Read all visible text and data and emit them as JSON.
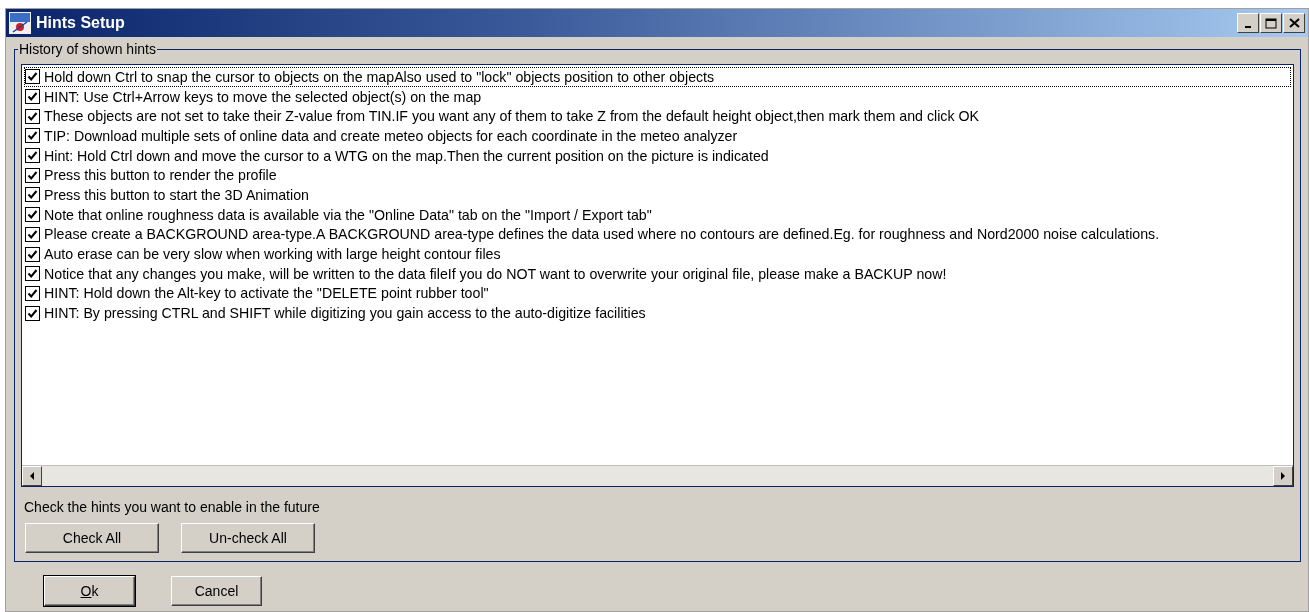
{
  "window": {
    "title": "Hints Setup"
  },
  "group": {
    "title": "History of shown hints"
  },
  "hints": [
    {
      "text": "Hold down Ctrl to snap the cursor to objects on the mapAlso used to \"lock\" objects position to other objects",
      "checked": true,
      "selected": true
    },
    {
      "text": "HINT: Use Ctrl+Arrow keys to move the selected object(s) on the map",
      "checked": true,
      "selected": false
    },
    {
      "text": "These objects are not set to take their Z-value from TIN.IF you want any of them to take Z from the default height object,then mark them and click OK",
      "checked": true,
      "selected": false
    },
    {
      "text": "TIP: Download multiple sets of online data and create meteo objects for each coordinate in the meteo analyzer",
      "checked": true,
      "selected": false
    },
    {
      "text": "Hint: Hold Ctrl down and move the cursor to a WTG on the map.Then the current position on the picture is indicated",
      "checked": true,
      "selected": false
    },
    {
      "text": "Press this button to render the profile",
      "checked": true,
      "selected": false
    },
    {
      "text": "Press this button to start the 3D Animation",
      "checked": true,
      "selected": false
    },
    {
      "text": "Note that online roughness data is available via the \"Online Data\" tab on the \"Import / Export tab\"",
      "checked": true,
      "selected": false
    },
    {
      "text": "Please create a BACKGROUND area-type.A BACKGROUND area-type defines the data used where no contours are defined.Eg. for roughness and Nord2000 noise calculations.",
      "checked": true,
      "selected": false
    },
    {
      "text": "Auto erase can be very slow when working with large height contour files",
      "checked": true,
      "selected": false
    },
    {
      "text": "Notice that any changes you make, will be written to the data fileIf you do NOT want to overwrite your original file, please make a BACKUP now!",
      "checked": true,
      "selected": false
    },
    {
      "text": "HINT: Hold down the Alt-key to activate the \"DELETE point rubber tool\"",
      "checked": true,
      "selected": false
    },
    {
      "text": "HINT: By pressing CTRL and SHIFT while digitizing you gain access to the auto-digitize facilities",
      "checked": true,
      "selected": false
    }
  ],
  "instruction": "Check the hints you want to enable in the future",
  "group_buttons": [
    "Check All",
    "Un-check All"
  ],
  "dialog_buttons": [
    {
      "label": "Ok",
      "default": true
    },
    {
      "label": "Cancel",
      "default": false
    }
  ]
}
